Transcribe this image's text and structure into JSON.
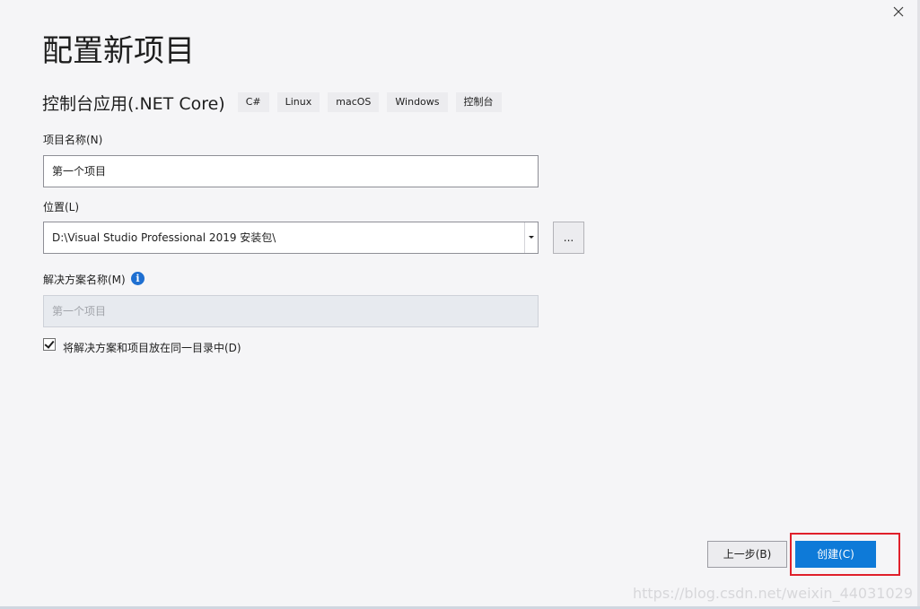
{
  "window": {
    "close_icon": "close-icon"
  },
  "page_title": "配置新项目",
  "template": {
    "name": "控制台应用(.NET Core)",
    "tags": [
      "C#",
      "Linux",
      "macOS",
      "Windows",
      "控制台"
    ]
  },
  "project_name": {
    "label": "项目名称(N)",
    "value": "第一个项目"
  },
  "location": {
    "label": "位置(L)",
    "value": "D:\\Visual Studio Professional 2019 安装包\\",
    "browse_label": "..."
  },
  "solution_name": {
    "label": "解决方案名称(M)",
    "info_icon": "info-icon",
    "placeholder": "第一个项目"
  },
  "same_directory": {
    "checked": true,
    "label": "将解决方案和项目放在同一目录中(D)"
  },
  "footer": {
    "back_label": "上一步(B)",
    "create_label": "创建(C)"
  },
  "watermark": "https://blog.csdn.net/weixin_44031029",
  "colors": {
    "accent": "#0e7ad8",
    "highlight": "#e0202b"
  }
}
